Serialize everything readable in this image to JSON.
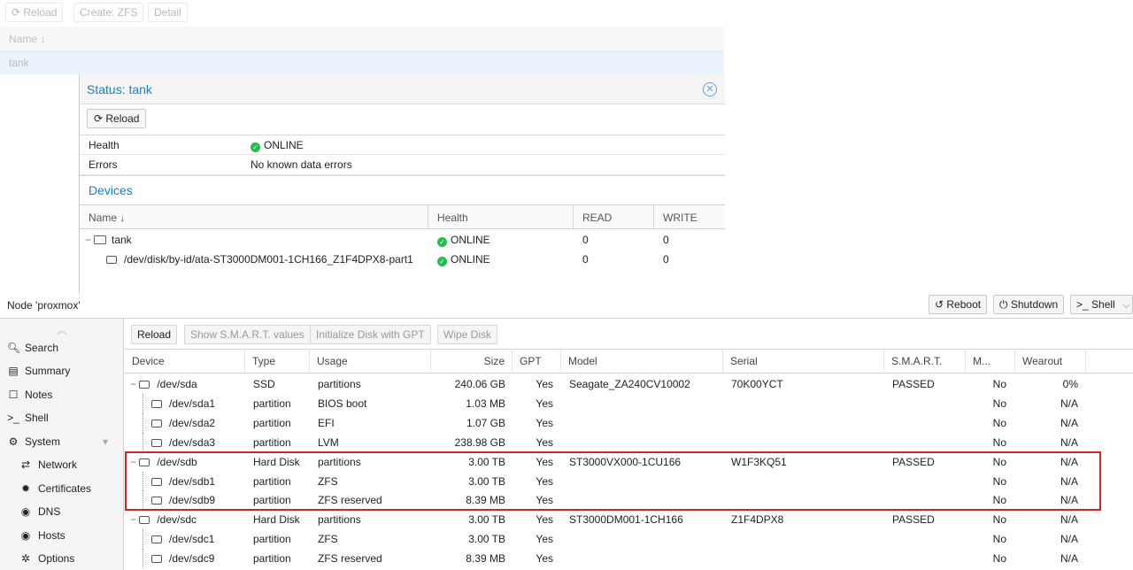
{
  "zfs_toolbar": {
    "reload": "Reload",
    "create": "Create: ZFS",
    "detail": "Detail"
  },
  "zfs_list": {
    "header": "Name ↓",
    "row": "tank"
  },
  "status_window": {
    "title": "Status: tank",
    "reload_label": "Reload",
    "health_label": "Health",
    "health_value": "ONLINE",
    "errors_label": "Errors",
    "errors_value": "No known data errors",
    "devices_title": "Devices",
    "columns": {
      "name": "Name ↓",
      "health": "Health",
      "read": "READ",
      "write": "WRITE"
    },
    "rows": [
      {
        "name": "tank",
        "health": "ONLINE",
        "read": "0",
        "write": "0"
      },
      {
        "name": "/dev/disk/by-id/ata-ST3000DM001-1CH166_Z1F4DPX8-part1",
        "health": "ONLINE",
        "read": "0",
        "write": "0"
      }
    ]
  },
  "node": {
    "title": "Node 'proxmox'",
    "reboot": "Reboot",
    "shutdown": "Shutdown",
    "shell": "Shell"
  },
  "sidebar": {
    "items": [
      {
        "label": "Search"
      },
      {
        "label": "Summary"
      },
      {
        "label": "Notes"
      },
      {
        "label": "Shell"
      },
      {
        "label": "System"
      },
      {
        "label": "Network"
      },
      {
        "label": "Certificates"
      },
      {
        "label": "DNS"
      },
      {
        "label": "Hosts"
      },
      {
        "label": "Options"
      }
    ]
  },
  "disk_toolbar": {
    "reload": "Reload",
    "smart": "Show S.M.A.R.T. values",
    "init_gpt": "Initialize Disk with GPT",
    "wipe": "Wipe Disk"
  },
  "disk_columns": {
    "device": "Device",
    "type": "Type",
    "usage": "Usage",
    "size": "Size",
    "gpt": "GPT",
    "model": "Model",
    "serial": "Serial",
    "smart": "S.M.A.R.T.",
    "mounted": "M...",
    "wearout": "Wearout"
  },
  "disks": [
    {
      "device": "/dev/sda",
      "type": "SSD",
      "usage": "partitions",
      "size": "240.06 GB",
      "gpt": "Yes",
      "model": "Seagate_ZA240CV10002",
      "serial": "70K00YCT",
      "smart": "PASSED",
      "mounted": "No",
      "wearout": "0%"
    },
    {
      "device": "/dev/sda1",
      "type": "partition",
      "usage": "BIOS boot",
      "size": "1.03 MB",
      "gpt": "Yes",
      "model": "",
      "serial": "",
      "smart": "",
      "mounted": "No",
      "wearout": "N/A"
    },
    {
      "device": "/dev/sda2",
      "type": "partition",
      "usage": "EFI",
      "size": "1.07 GB",
      "gpt": "Yes",
      "model": "",
      "serial": "",
      "smart": "",
      "mounted": "No",
      "wearout": "N/A"
    },
    {
      "device": "/dev/sda3",
      "type": "partition",
      "usage": "LVM",
      "size": "238.98 GB",
      "gpt": "Yes",
      "model": "",
      "serial": "",
      "smart": "",
      "mounted": "No",
      "wearout": "N/A"
    },
    {
      "device": "/dev/sdb",
      "type": "Hard Disk",
      "usage": "partitions",
      "size": "3.00 TB",
      "gpt": "Yes",
      "model": "ST3000VX000-1CU166",
      "serial": "W1F3KQ51",
      "smart": "PASSED",
      "mounted": "No",
      "wearout": "N/A"
    },
    {
      "device": "/dev/sdb1",
      "type": "partition",
      "usage": "ZFS",
      "size": "3.00 TB",
      "gpt": "Yes",
      "model": "",
      "serial": "",
      "smart": "",
      "mounted": "No",
      "wearout": "N/A"
    },
    {
      "device": "/dev/sdb9",
      "type": "partition",
      "usage": "ZFS reserved",
      "size": "8.39 MB",
      "gpt": "Yes",
      "model": "",
      "serial": "",
      "smart": "",
      "mounted": "No",
      "wearout": "N/A"
    },
    {
      "device": "/dev/sdc",
      "type": "Hard Disk",
      "usage": "partitions",
      "size": "3.00 TB",
      "gpt": "Yes",
      "model": "ST3000DM001-1CH166",
      "serial": "Z1F4DPX8",
      "smart": "PASSED",
      "mounted": "No",
      "wearout": "N/A"
    },
    {
      "device": "/dev/sdc1",
      "type": "partition",
      "usage": "ZFS",
      "size": "3.00 TB",
      "gpt": "Yes",
      "model": "",
      "serial": "",
      "smart": "",
      "mounted": "No",
      "wearout": "N/A"
    },
    {
      "device": "/dev/sdc9",
      "type": "partition",
      "usage": "ZFS reserved",
      "size": "8.39 MB",
      "gpt": "Yes",
      "model": "",
      "serial": "",
      "smart": "",
      "mounted": "No",
      "wearout": "N/A"
    }
  ],
  "highlight_color": "#d0232a",
  "accent_color": "#157fcc"
}
